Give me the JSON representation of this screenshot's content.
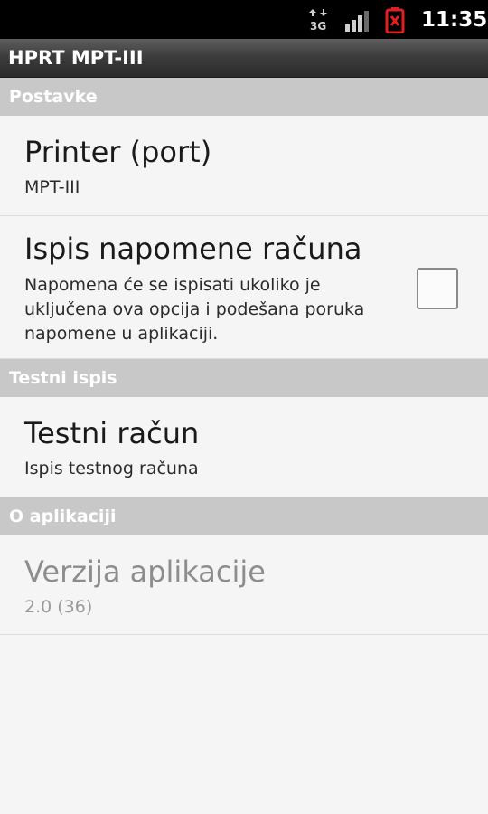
{
  "status_bar": {
    "network_icon": "3g-data-icon",
    "signal_icon": "signal-icon",
    "battery_icon": "battery-alert-icon",
    "time": "11:35",
    "battery_color": "#e02020"
  },
  "title_bar": {
    "title": "HPRT MPT-III"
  },
  "categories": [
    {
      "label": "Postavke"
    },
    {
      "label": "Testni ispis"
    },
    {
      "label": "O aplikaciji"
    }
  ],
  "preferences": {
    "printer": {
      "title": "Printer (port)",
      "summary": "MPT-III"
    },
    "note": {
      "title": "Ispis napomene računa",
      "summary_lines": [
        "Napomena će se ispisati ukoliko je",
        "uključena ova opcija i podešana poruka",
        "napomene u aplikaciji."
      ],
      "checked": false
    },
    "test_receipt": {
      "title": "Testni račun",
      "summary": "Ispis testnog računa"
    },
    "version": {
      "title": "Verzija aplikacije",
      "summary": "2.0 (36)",
      "enabled": false
    }
  }
}
